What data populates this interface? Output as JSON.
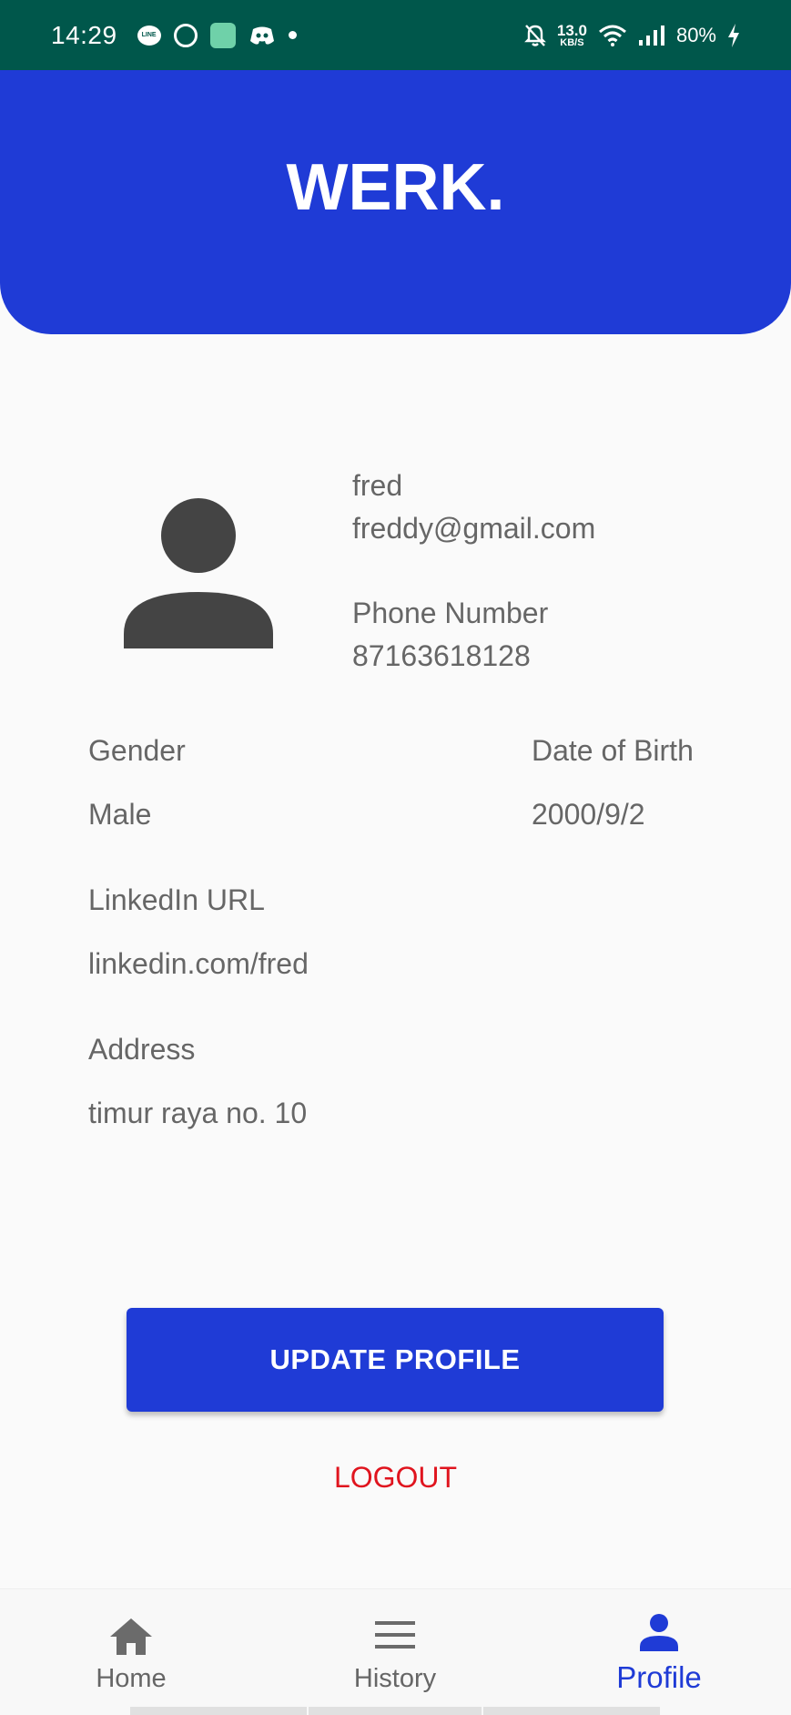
{
  "status_bar": {
    "time": "14:29",
    "line_label": "LINE",
    "net_speed_value": "13.0",
    "net_speed_unit": "KB/S",
    "battery": "80%",
    "icons": [
      "line-icon",
      "whatsapp-icon",
      "app-icon",
      "discord-icon",
      "dot-icon",
      "bell-off-icon",
      "wifi-icon",
      "signal-icon",
      "charging-icon"
    ]
  },
  "header": {
    "title": "WERK."
  },
  "profile": {
    "name": "fred",
    "email": "freddy@gmail.com",
    "phone_label": "Phone Number",
    "phone": "87163618128",
    "gender_label": "Gender",
    "gender": "Male",
    "dob_label": "Date of Birth",
    "dob": "2000/9/2",
    "linkedin_label": "LinkedIn URL",
    "linkedin": "linkedin.com/fred",
    "address_label": "Address",
    "address": "timur raya no. 10"
  },
  "actions": {
    "update_label": "UPDATE PROFILE",
    "logout_label": "LOGOUT"
  },
  "nav": {
    "items": [
      {
        "label": "Home",
        "icon": "home-icon",
        "active": false
      },
      {
        "label": "History",
        "icon": "menu-icon",
        "active": false
      },
      {
        "label": "Profile",
        "icon": "person-icon",
        "active": true
      }
    ]
  },
  "colors": {
    "status_bar": "#00574b",
    "primary": "#1f3bd6",
    "logout": "#e0141e",
    "text": "#666666",
    "background": "#fafafa"
  }
}
